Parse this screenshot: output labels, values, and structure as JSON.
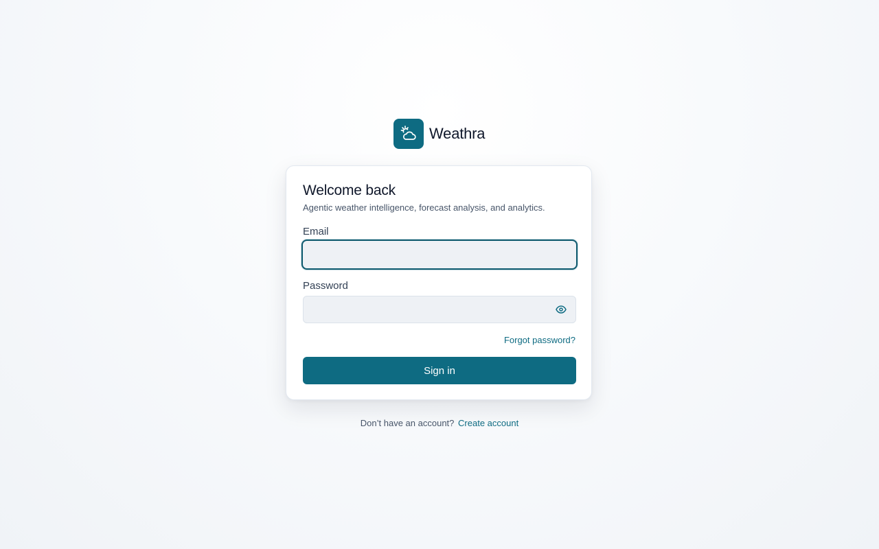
{
  "brand": {
    "name": "Weathra",
    "logo_icon": "sun-cloud-icon",
    "color": "#0e6b82"
  },
  "card": {
    "title": "Welcome back",
    "subtitle": "Agentic weather intelligence, forecast analysis, and analytics."
  },
  "form": {
    "email_label": "Email",
    "email_value": "",
    "email_placeholder": "",
    "password_label": "Password",
    "password_value": "",
    "password_placeholder": "",
    "password_toggle_icon": "eye-icon",
    "forgot_password": "Forgot password?",
    "submit_label": "Sign in"
  },
  "footer": {
    "prompt": "Don’t have an account?",
    "link": "Create account"
  }
}
